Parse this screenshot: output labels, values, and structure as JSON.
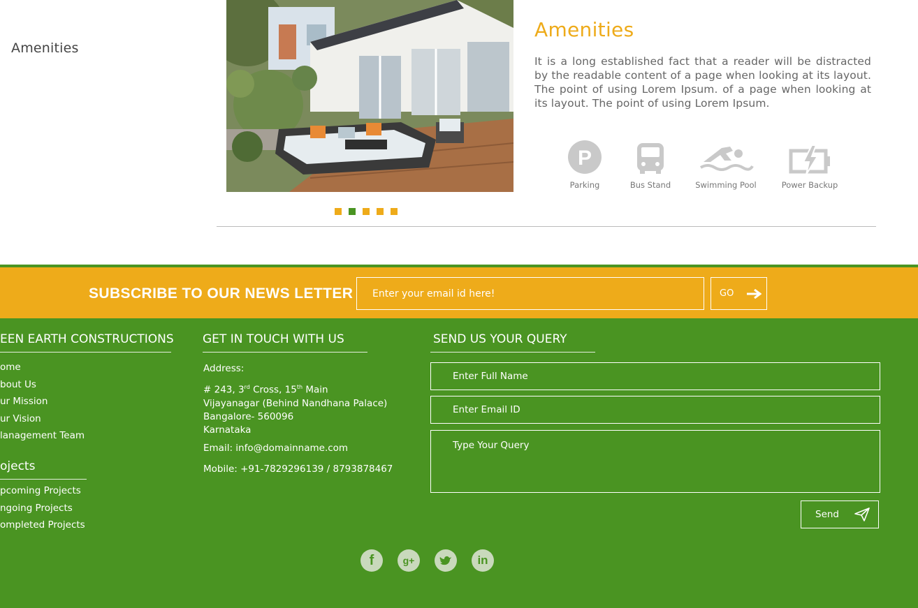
{
  "sidebar": {
    "label": "Amenities"
  },
  "amenities": {
    "title": "Amenities",
    "description": "It is a long established fact that a reader will be distracted by the readable content of a page when looking at its layout. The point of using Lorem Ipsum. of a page when looking at its layout. The point of using Lorem Ipsum.",
    "items": [
      {
        "label": "Parking",
        "icon": "parking-icon"
      },
      {
        "label": "Bus Stand",
        "icon": "bus-icon"
      },
      {
        "label": "Swimming Pool",
        "icon": "swimming-icon"
      },
      {
        "label": "Power Backup",
        "icon": "battery-icon"
      }
    ]
  },
  "slider": {
    "dot_count": 5,
    "active_index": 1
  },
  "subscribe": {
    "title": "SUBSCRIBE TO OUR NEWS LETTER",
    "placeholder": "Enter your email id here!",
    "go_label": "GO"
  },
  "footer": {
    "company_heading": "EEN EARTH CONSTRUCTIONS",
    "company_links": [
      "ome",
      "bout Us",
      "ur Mission",
      "ur Vision",
      "lanagement Team"
    ],
    "projects_heading": "ojects",
    "project_links": [
      "pcoming Projects",
      "ngoing Projects",
      "ompleted Projects"
    ],
    "contact_heading": "GET IN TOUCH WITH US",
    "address_label": "Address:",
    "address_line1_a": "# 243, 3",
    "address_line1_sup1": "rd",
    "address_line1_b": " Cross, 15",
    "address_line1_sup2": "th",
    "address_line1_c": " Main",
    "address_line2": "Vijayanagar (Behind Nandhana Palace)",
    "address_line3": "Bangalore- 560096",
    "address_line4": "Karnataka",
    "email": "Email: info@domainname.com",
    "mobile": "Mobile: +91-7829296139 / 8793878467",
    "query_heading": "SEND US YOUR QUERY",
    "name_placeholder": "Enter Full Name",
    "email_placeholder": "Enter Email ID",
    "query_placeholder": "Type Your Query",
    "send_label": "Send",
    "social": [
      "facebook-icon",
      "google-plus-icon",
      "twitter-icon",
      "linkedin-icon"
    ]
  },
  "colors": {
    "accent": "#eeab1a",
    "brand_green": "#4a9422"
  }
}
